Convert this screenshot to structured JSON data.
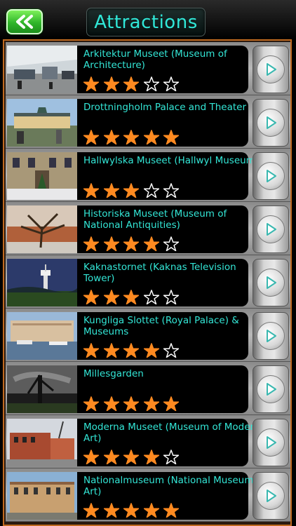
{
  "header": {
    "title": "Attractions",
    "back_icon": "double-chevron-left-icon",
    "back_color": "#3cc634",
    "title_color": "#30e8d8"
  },
  "accent": {
    "frame": "#c06a20",
    "star_filled": "#ff8a20",
    "star_empty": "#ffffff"
  },
  "attractions": [
    {
      "name": "Arkitektur Museet (Museum of Architecture)",
      "rating": 3,
      "thumb": "architecture-museum-photo"
    },
    {
      "name": "Drottningholm Palace and Theater",
      "rating": 5,
      "thumb": "drottningholm-palace-photo"
    },
    {
      "name": "Hallwylska Museet (Hallwyl Museum)",
      "rating": 3,
      "thumb": "hallwyl-museum-photo"
    },
    {
      "name": "Historiska Museet (Museum of National Antiquities)",
      "rating": 4,
      "thumb": "historical-museum-photo"
    },
    {
      "name": "Kaknastornet (Kaknas Television Tower)",
      "rating": 3,
      "thumb": "kaknas-tower-photo"
    },
    {
      "name": "Kungliga Slottet (Royal Palace) & Museums",
      "rating": 4,
      "thumb": "royal-palace-photo"
    },
    {
      "name": "Millesgarden",
      "rating": 5,
      "thumb": "millesgarden-photo"
    },
    {
      "name": "Moderna Museet (Museum of Modern Art)",
      "rating": 4,
      "thumb": "modern-museum-photo"
    },
    {
      "name": "Nationalmuseum (National Museum of Art)",
      "rating": 5,
      "thumb": "national-museum-photo"
    }
  ]
}
